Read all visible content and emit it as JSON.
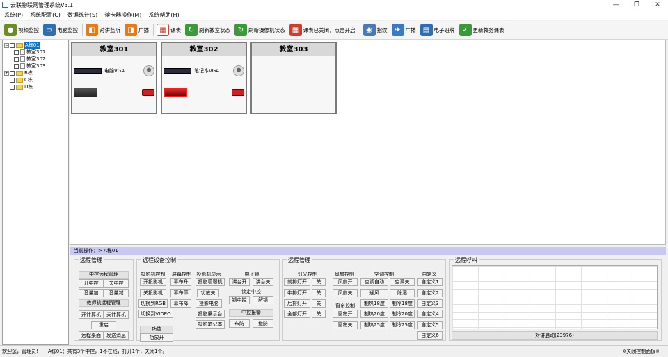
{
  "window": {
    "title": "云联物联网管理系统V3.1",
    "min": "—",
    "max": "❐",
    "close": "✕"
  },
  "menu": [
    "系统(P)",
    "系统配置(C)",
    "数据统计(S)",
    "读卡器操作(M)",
    "系统帮助(H)"
  ],
  "toolbar": [
    {
      "label": "视频监控",
      "icon": "camera-icon",
      "color": "#6b8e23"
    },
    {
      "label": "电脑监控",
      "icon": "monitor-icon",
      "color": "#2f6fb0"
    },
    {
      "label": "对讲监听",
      "icon": "intercom-icon",
      "color": "#e07b20"
    },
    {
      "label": "广播",
      "icon": "broadcast-icon",
      "color": "#e07b20"
    },
    {
      "label": "课表",
      "icon": "schedule-icon",
      "color": "#c84030"
    },
    {
      "label": "刷新教室状态",
      "icon": "refresh-icon",
      "color": "#3a9a3a"
    },
    {
      "label": "刷新摄像机状态",
      "icon": "refresh-icon",
      "color": "#3a9a3a"
    },
    {
      "label": "课表已关闭，点击开启",
      "icon": "schedule-off-icon",
      "color": "#c84030"
    },
    {
      "label": "指纹",
      "icon": "fingerprint-icon",
      "color": "#4a7ab5"
    },
    {
      "label": "广播",
      "icon": "antenna-icon",
      "color": "#3a78c8"
    },
    {
      "label": "电子班牌",
      "icon": "eboard-icon",
      "color": "#2f6fb0"
    },
    {
      "label": "更新教务课表",
      "icon": "update-icon",
      "color": "#3a9a3a"
    }
  ],
  "tree": {
    "root": "A栋01",
    "rooms": [
      "教室301",
      "教室302",
      "教室303"
    ],
    "others": [
      "B栋",
      "C栋",
      "D栋"
    ]
  },
  "rooms": [
    {
      "name": "教室301",
      "device1": "电脑VGA"
    },
    {
      "name": "教室302",
      "device1": "笔记本VGA"
    },
    {
      "name": "教室303",
      "device1": ""
    }
  ],
  "current_op": "当前操作：> A栋01",
  "remote_mgmt": {
    "title": "远程管理",
    "center_title": "中控远程管理",
    "open": "开中控",
    "close": "关中控",
    "vol_up": "音量加",
    "vol_down": "音量减",
    "teacher_title": "教师机远程管理",
    "pc_on": "开计算机",
    "pc_off": "关计算机",
    "restart": "重启",
    "desktop": "远程桌面",
    "msg": "发送消息"
  },
  "device_ctrl": {
    "title": "远程设备控制",
    "proj_title": "投影机控制",
    "screen_title": "屏幕控制",
    "display_title": "投影机显示",
    "lock_title": "电子锁",
    "proj_on": "开投影机",
    "proj_off": "关投影机",
    "sw_rgb": "切换到RGB",
    "sw_video": "切换到VIDEO",
    "sc_up": "幕布升",
    "sc_stop": "幕布停",
    "sc_down": "幕布降",
    "wall": "投影墙曝机",
    "amp_off": "功放关",
    "proj_pc": "投影电脑",
    "proj_stage": "投影展示台",
    "proj_nb": "投影笔记本",
    "podium_on": "讲台开",
    "podium_off": "讲台关",
    "lock_center": "锁定中控",
    "lock_c": "锁中控",
    "unlock": "解锁",
    "alarm_title": "中控报警",
    "arm": "布防",
    "disarm": "撤防",
    "amp_title": "功放",
    "amp_on": "功放开"
  },
  "env_ctrl": {
    "title": "远程管理",
    "light_title": "灯光控制",
    "fan_title": "风扇控制",
    "ac_title": "空调控制",
    "custom_title": "自定义",
    "lights": [
      [
        "前排灯开",
        "关"
      ],
      [
        "中排灯开",
        "关"
      ],
      [
        "后排灯开",
        "关"
      ],
      [
        "全部灯开",
        "关"
      ]
    ],
    "fan_on": "风扇开",
    "fan_off": "风扇关",
    "curtain_title": "窗帘控制",
    "curtain_on": "窗帘开",
    "curtain_off": "窗帘关",
    "ac_auto": "空调自动",
    "ac_off": "空调关",
    "ac_fan": "通风",
    "ac_dry": "除湿",
    "ac_rows": [
      [
        "制热18度",
        "制冷18度"
      ],
      [
        "制热20度",
        "制冷20度"
      ],
      [
        "制热25度",
        "制冷25度"
      ]
    ],
    "custom": [
      "自定义1",
      "自定义2",
      "自定义3",
      "自定义4",
      "自定义5",
      "自定义6"
    ]
  },
  "intercom": {
    "title": "远程呼叫",
    "status": "对讲启动(23976)"
  },
  "status": {
    "welcome": "欢迎您，管理员!",
    "summary": "A栋01：共有3个中控，1不在线，打开1个，关闭1个。",
    "panel": "※关闭控制面板※"
  }
}
